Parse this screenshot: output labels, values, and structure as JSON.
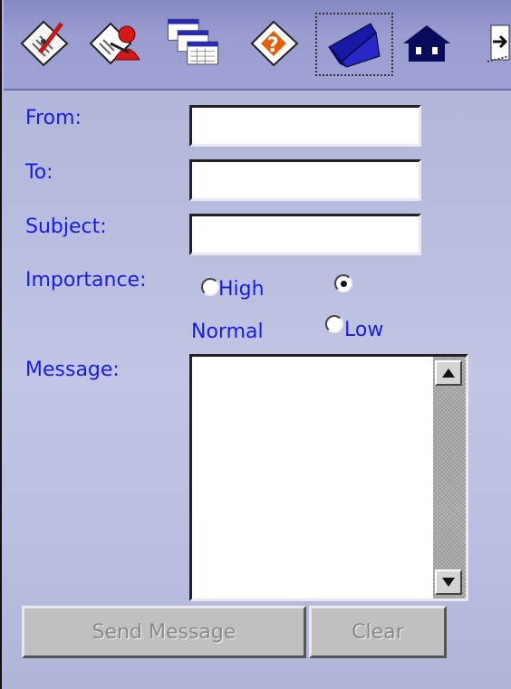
{
  "toolbar": {
    "items": [
      {
        "icon": "clipboard-pen-icon"
      },
      {
        "icon": "clipboard-user-icon"
      },
      {
        "icon": "calendar-stack-icon"
      },
      {
        "icon": "clipboard-help-icon"
      },
      {
        "icon": "folder-envelope-icon",
        "active": true
      },
      {
        "icon": "home-icon"
      },
      {
        "icon": "exit-icon"
      }
    ]
  },
  "form": {
    "from_label": "From:",
    "to_label": "To:",
    "subject_label": "Subject:",
    "importance_label": "Importance:",
    "message_label": "Message:",
    "from_value": "",
    "to_value": "",
    "subject_value": "",
    "message_value": "",
    "importance": {
      "options": [
        "High",
        "Normal",
        "Low"
      ],
      "selected": "Normal"
    }
  },
  "buttons": {
    "send_label": "Send Message",
    "clear_label": "Clear"
  },
  "colors": {
    "label": "#1a1ae6",
    "toolbar": "#9a9dd0",
    "background": "#b9bddf"
  }
}
